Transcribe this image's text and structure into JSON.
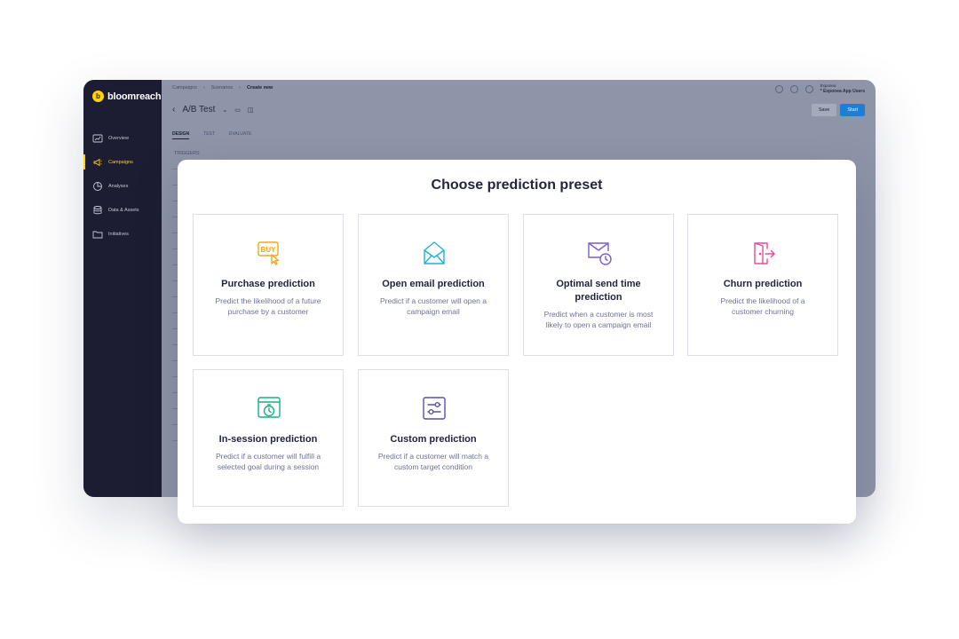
{
  "app": {
    "brand": "bloomreach",
    "brand_logo_letter": "b",
    "nav": [
      {
        "label": "Overview",
        "icon": "dashboard-icon"
      },
      {
        "label": "Campaigns",
        "icon": "megaphone-icon"
      },
      {
        "label": "Analyses",
        "icon": "pie-chart-icon"
      },
      {
        "label": "Data & Assets",
        "icon": "database-icon"
      },
      {
        "label": "Initiatives",
        "icon": "folder-icon"
      }
    ],
    "active_nav": "Campaigns",
    "breadcrumb": [
      "Campaigns",
      "Scenarios",
      "Create new"
    ],
    "title": "A/B Test",
    "tabs": [
      "DESIGN",
      "TEST",
      "EVALUATE"
    ],
    "active_tab": "DESIGN",
    "triggers_label": "TRIGGERS",
    "project_label": "Exponea",
    "project_value": "* Exponea App Users",
    "save_label": "Save",
    "start_label": "Start"
  },
  "modal": {
    "title": "Choose prediction preset",
    "cards": [
      {
        "title": "Purchase prediction",
        "description": "Predict the likelihood of a future purchase by a customer",
        "icon": "buy-tag-icon",
        "color": "#f2a51a"
      },
      {
        "title": "Open email prediction",
        "description": "Predict if a customer will open a campaign email",
        "icon": "open-envelope-icon",
        "color": "#1fb2d6"
      },
      {
        "title": "Optimal send time prediction",
        "description": "Predict when a customer is most likely to open a campaign email",
        "icon": "envelope-clock-icon",
        "color": "#7a5cd6"
      },
      {
        "title": "Churn prediction",
        "description": "Predict the likelihood of a customer churning",
        "icon": "exit-door-icon",
        "color": "#e84a9c"
      },
      {
        "title": "In-session prediction",
        "description": "Predict if a customer will fulfill a selected goal during a session",
        "icon": "browser-timer-icon",
        "color": "#18b07a"
      },
      {
        "title": "Custom prediction",
        "description": "Predict if a customer will match a custom target condition",
        "icon": "sliders-icon",
        "color": "#5b4fa8"
      }
    ]
  }
}
